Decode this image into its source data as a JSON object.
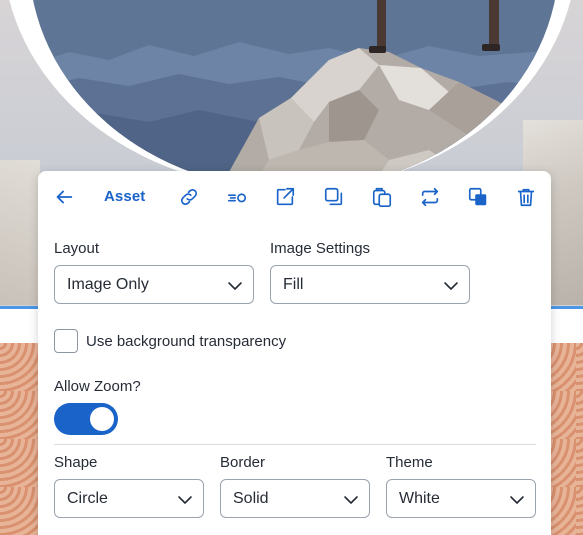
{
  "toolbar": {
    "title": "Asset",
    "buttons": [
      {
        "name": "back-button",
        "icon": "arrow-left-icon"
      },
      {
        "name": "link-button",
        "icon": "link-icon"
      },
      {
        "name": "focal-point-button",
        "icon": "focal-point-icon"
      },
      {
        "name": "open-external-button",
        "icon": "external-link-icon"
      },
      {
        "name": "duplicate-button",
        "icon": "duplicate-icon"
      },
      {
        "name": "paste-button",
        "icon": "clipboard-icon"
      },
      {
        "name": "replace-button",
        "icon": "swap-icon"
      },
      {
        "name": "arrange-button",
        "icon": "layers-icon"
      },
      {
        "name": "delete-button",
        "icon": "trash-icon"
      }
    ]
  },
  "layout": {
    "label": "Layout",
    "value": "Image Only"
  },
  "image_settings": {
    "label": "Image Settings",
    "value": "Fill"
  },
  "transparency": {
    "label": "Use background transparency",
    "checked": false
  },
  "zoom": {
    "label": "Allow Zoom?",
    "enabled": true
  },
  "shape": {
    "label": "Shape",
    "value": "Circle"
  },
  "border": {
    "label": "Border",
    "value": "Solid"
  },
  "theme": {
    "label": "Theme",
    "value": "White"
  },
  "colors": {
    "accent": "#1a63c8",
    "text": "#262c36",
    "divider": "#d9dde2",
    "highlight_line": "#4a96e8"
  }
}
